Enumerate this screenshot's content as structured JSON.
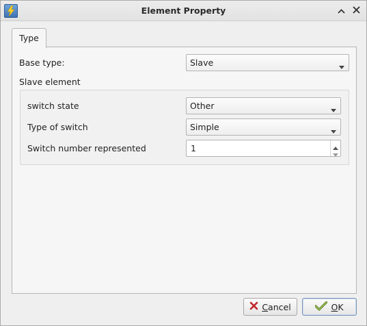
{
  "window": {
    "title": "Element Property",
    "icons": {
      "app": "lightning-app-icon",
      "minimize": "chevron-up-icon",
      "close": "close-icon"
    }
  },
  "tabs": [
    {
      "label": "Type",
      "selected": true
    }
  ],
  "form": {
    "base_type": {
      "label": "Base type:",
      "value": "Slave"
    },
    "section_label": "Slave element",
    "switch_state": {
      "label": "switch state",
      "value": "Other"
    },
    "type_of_switch": {
      "label": "Type of switch",
      "value": "Simple"
    },
    "switch_number": {
      "label": "Switch number represented",
      "value": "1"
    }
  },
  "buttons": {
    "cancel": {
      "label_mnemonic": "C",
      "label_rest": "ancel",
      "icon": "red-x-icon"
    },
    "ok": {
      "label_mnemonic": "O",
      "label_rest": "K",
      "icon": "green-check-icon"
    }
  }
}
